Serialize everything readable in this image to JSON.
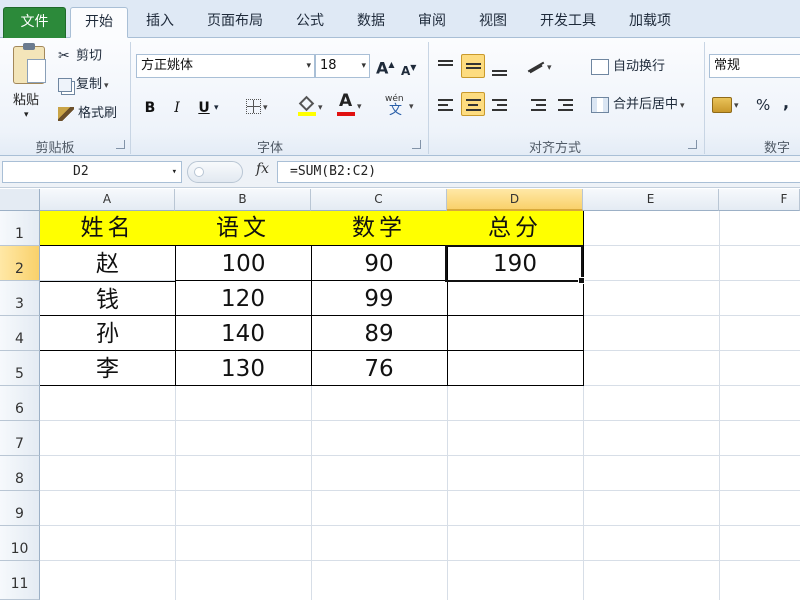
{
  "tabs": [
    "文件",
    "开始",
    "插入",
    "页面布局",
    "公式",
    "数据",
    "审阅",
    "视图",
    "开发工具",
    "加载项"
  ],
  "clipboard": {
    "paste": "粘贴",
    "cut": "剪切",
    "copy": "复制",
    "format_painter": "格式刷",
    "label": "剪贴板"
  },
  "font": {
    "name": "方正姚体",
    "size": "18",
    "label": "字体",
    "bold": "B",
    "italic": "I",
    "underline": "U",
    "grow": "A",
    "shrink": "A",
    "font_color_glyph": "A",
    "phonetic_glyph": "wén"
  },
  "alignment": {
    "wrap_text": "自动换行",
    "merge_center": "合并后居中",
    "label": "对齐方式"
  },
  "number": {
    "format": "常规",
    "percent": "%",
    "comma": ",",
    "label": "数字"
  },
  "formula_bar": {
    "name_box": "D2",
    "fx": "fx",
    "formula": "=SUM(B2:C2)"
  },
  "columns": [
    "A",
    "B",
    "C",
    "D",
    "E",
    "F"
  ],
  "rows": [
    "1",
    "2",
    "3",
    "4",
    "5",
    "6",
    "7",
    "8",
    "9",
    "10",
    "11"
  ],
  "table": {
    "headers": [
      "姓名",
      "语文",
      "数学",
      "总分"
    ],
    "data": [
      [
        "赵",
        "100",
        "90",
        "190"
      ],
      [
        "钱",
        "120",
        "99",
        ""
      ],
      [
        "孙",
        "140",
        "89",
        ""
      ],
      [
        "李",
        "130",
        "76",
        ""
      ]
    ]
  },
  "active_cell": "D2",
  "colors": {
    "header_fill": "#ffff00",
    "file_tab": "#2c8a3a",
    "selection": "#fddc80"
  }
}
